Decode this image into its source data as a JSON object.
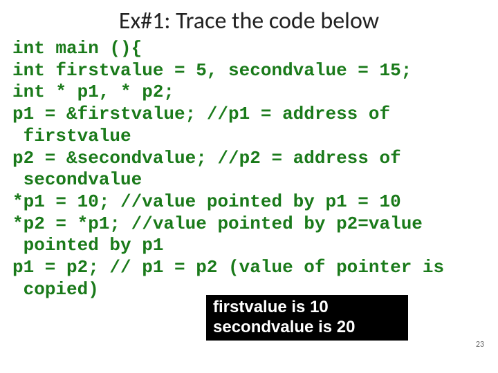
{
  "slide": {
    "title": "Ex#1: Trace the code below",
    "code": "int main (){\nint firstvalue = 5, secondvalue = 15;\nint * p1, * p2;\np1 = &firstvalue; //p1 = address of\n firstvalue\np2 = &secondvalue; //p2 = address of\n secondvalue\n*p1 = 10; //value pointed by p1 = 10\n*p2 = *p1; //value pointed by p2=value\n pointed by p1\np1 = p2; // p1 = p2 (value of pointer is\n copied)",
    "overlay_line1": "firstvalue is 10",
    "overlay_line2": "secondvalue is 20",
    "page_number": "23"
  }
}
